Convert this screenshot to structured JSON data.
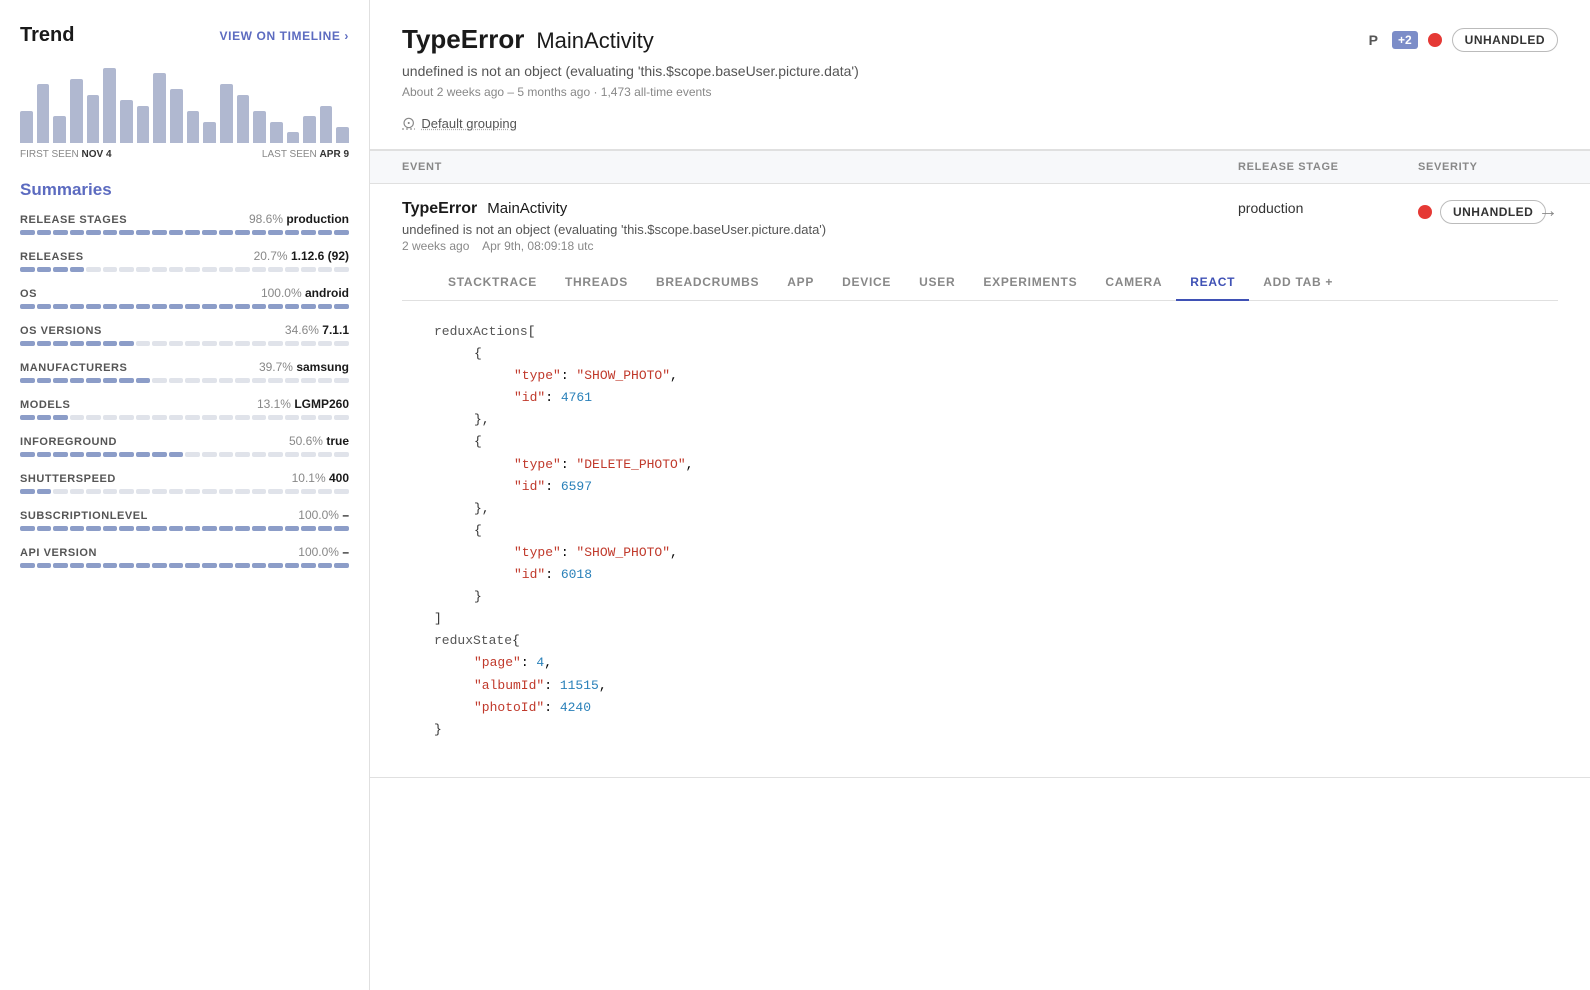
{
  "sidebar": {
    "title": "Trend",
    "view_timeline_label": "VIEW ON TIMELINE ›",
    "chart": {
      "bars": [
        30,
        55,
        25,
        60,
        45,
        70,
        40,
        35,
        65,
        50,
        30,
        20,
        55,
        45,
        30,
        20,
        10,
        25,
        35,
        15
      ],
      "first_seen_label": "FIRST SEEN",
      "first_seen_date": "NOV 4",
      "last_seen_label": "LAST SEEN",
      "last_seen_date": "APR 9"
    },
    "summaries_title": "Summaries",
    "summaries": [
      {
        "label": "RELEASE STAGES",
        "percent": "98.6%",
        "value": "production",
        "fill_width": 98.6
      },
      {
        "label": "RELEASES",
        "percent": "20.7%",
        "value": "1.12.6 (92)",
        "fill_width": 20.7
      },
      {
        "label": "OS",
        "percent": "100.0%",
        "value": "android",
        "fill_width": 100
      },
      {
        "label": "OS VERSIONS",
        "percent": "34.6%",
        "value": "7.1.1",
        "fill_width": 34.6
      },
      {
        "label": "MANUFACTURERS",
        "percent": "39.7%",
        "value": "samsung",
        "fill_width": 39.7
      },
      {
        "label": "MODELS",
        "percent": "13.1%",
        "value": "LGMP260",
        "fill_width": 13.1
      },
      {
        "label": "INFOREGROUND",
        "percent": "50.6%",
        "value": "true",
        "fill_width": 50.6
      },
      {
        "label": "SHUTTERSPEED",
        "percent": "10.1%",
        "value": "400",
        "fill_width": 10.1
      },
      {
        "label": "SUBSCRIPTIONLEVEL",
        "percent": "100.0%",
        "value": "–",
        "fill_width": 100
      },
      {
        "label": "API VERSION",
        "percent": "100.0%",
        "value": "–",
        "fill_width": 100
      }
    ]
  },
  "error": {
    "type": "TypeError",
    "location": "MainActivity",
    "subtitle": "undefined is not an object (evaluating 'this.$scope.baseUser.picture.data')",
    "meta": "About 2 weeks ago – 5 months ago · 1,473 all-time events",
    "grouping_label": "Default grouping",
    "priority_label": "P",
    "priority_count": "+2",
    "severity_label": "UNHANDLED",
    "table_headers": {
      "event": "EVENT",
      "release_stage": "RELEASE STAGE",
      "severity": "SEVERITY"
    },
    "event": {
      "type": "TypeError",
      "location": "MainActivity",
      "subtitle": "undefined is not an object (evaluating 'this.$scope.baseUser.picture.data')",
      "time_ago": "2 weeks ago",
      "date": "Apr 9th, 08:09:18 utc",
      "release_stage": "production",
      "severity": "UNHANDLED"
    }
  },
  "tabs": [
    {
      "label": "STACKTRACE",
      "active": false
    },
    {
      "label": "THREADS",
      "active": false
    },
    {
      "label": "BREADCRUMBS",
      "active": false
    },
    {
      "label": "APP",
      "active": false
    },
    {
      "label": "DEVICE",
      "active": false
    },
    {
      "label": "USER",
      "active": false
    },
    {
      "label": "EXPERIMENTS",
      "active": false
    },
    {
      "label": "CAMERA",
      "active": false
    },
    {
      "label": "REACT",
      "active": true
    },
    {
      "label": "ADD TAB +",
      "active": false
    }
  ],
  "code": {
    "redux_actions_label": "reduxActions",
    "redux_state_label": "reduxState",
    "actions": [
      {
        "type": "SHOW_PHOTO",
        "id": 4761
      },
      {
        "type": "DELETE_PHOTO",
        "id": 6597
      },
      {
        "type": "SHOW_PHOTO",
        "id": 6018
      }
    ],
    "state": {
      "page": 4,
      "albumId": 11515,
      "photoId": 4240
    }
  }
}
